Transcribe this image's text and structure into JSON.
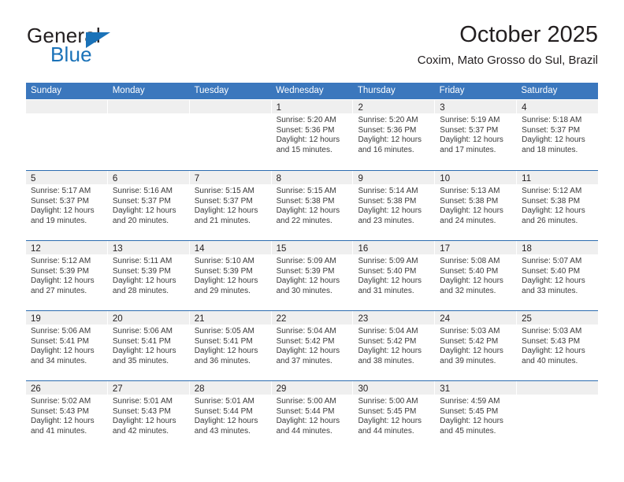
{
  "brand": {
    "name_part1": "General",
    "name_part2": "Blue",
    "triangle_icon": "triangle-icon",
    "accent_color": "#1a72b8"
  },
  "header": {
    "month_title": "October 2025",
    "location": "Coxim, Mato Grosso do Sul, Brazil"
  },
  "calendar": {
    "header_color": "#3b77bd",
    "row_divider_color": "#2c6cb0",
    "day_band_color": "#efefef",
    "weekdays": [
      "Sunday",
      "Monday",
      "Tuesday",
      "Wednesday",
      "Thursday",
      "Friday",
      "Saturday"
    ],
    "weeks": [
      [
        {
          "day": "",
          "empty": true
        },
        {
          "day": "",
          "empty": true
        },
        {
          "day": "",
          "empty": true
        },
        {
          "day": "1",
          "sunrise": "Sunrise: 5:20 AM",
          "sunset": "Sunset: 5:36 PM",
          "daylight_1": "Daylight: 12 hours",
          "daylight_2": "and 15 minutes."
        },
        {
          "day": "2",
          "sunrise": "Sunrise: 5:20 AM",
          "sunset": "Sunset: 5:36 PM",
          "daylight_1": "Daylight: 12 hours",
          "daylight_2": "and 16 minutes."
        },
        {
          "day": "3",
          "sunrise": "Sunrise: 5:19 AM",
          "sunset": "Sunset: 5:37 PM",
          "daylight_1": "Daylight: 12 hours",
          "daylight_2": "and 17 minutes."
        },
        {
          "day": "4",
          "sunrise": "Sunrise: 5:18 AM",
          "sunset": "Sunset: 5:37 PM",
          "daylight_1": "Daylight: 12 hours",
          "daylight_2": "and 18 minutes."
        }
      ],
      [
        {
          "day": "5",
          "sunrise": "Sunrise: 5:17 AM",
          "sunset": "Sunset: 5:37 PM",
          "daylight_1": "Daylight: 12 hours",
          "daylight_2": "and 19 minutes."
        },
        {
          "day": "6",
          "sunrise": "Sunrise: 5:16 AM",
          "sunset": "Sunset: 5:37 PM",
          "daylight_1": "Daylight: 12 hours",
          "daylight_2": "and 20 minutes."
        },
        {
          "day": "7",
          "sunrise": "Sunrise: 5:15 AM",
          "sunset": "Sunset: 5:37 PM",
          "daylight_1": "Daylight: 12 hours",
          "daylight_2": "and 21 minutes."
        },
        {
          "day": "8",
          "sunrise": "Sunrise: 5:15 AM",
          "sunset": "Sunset: 5:38 PM",
          "daylight_1": "Daylight: 12 hours",
          "daylight_2": "and 22 minutes."
        },
        {
          "day": "9",
          "sunrise": "Sunrise: 5:14 AM",
          "sunset": "Sunset: 5:38 PM",
          "daylight_1": "Daylight: 12 hours",
          "daylight_2": "and 23 minutes."
        },
        {
          "day": "10",
          "sunrise": "Sunrise: 5:13 AM",
          "sunset": "Sunset: 5:38 PM",
          "daylight_1": "Daylight: 12 hours",
          "daylight_2": "and 24 minutes."
        },
        {
          "day": "11",
          "sunrise": "Sunrise: 5:12 AM",
          "sunset": "Sunset: 5:38 PM",
          "daylight_1": "Daylight: 12 hours",
          "daylight_2": "and 26 minutes."
        }
      ],
      [
        {
          "day": "12",
          "sunrise": "Sunrise: 5:12 AM",
          "sunset": "Sunset: 5:39 PM",
          "daylight_1": "Daylight: 12 hours",
          "daylight_2": "and 27 minutes."
        },
        {
          "day": "13",
          "sunrise": "Sunrise: 5:11 AM",
          "sunset": "Sunset: 5:39 PM",
          "daylight_1": "Daylight: 12 hours",
          "daylight_2": "and 28 minutes."
        },
        {
          "day": "14",
          "sunrise": "Sunrise: 5:10 AM",
          "sunset": "Sunset: 5:39 PM",
          "daylight_1": "Daylight: 12 hours",
          "daylight_2": "and 29 minutes."
        },
        {
          "day": "15",
          "sunrise": "Sunrise: 5:09 AM",
          "sunset": "Sunset: 5:39 PM",
          "daylight_1": "Daylight: 12 hours",
          "daylight_2": "and 30 minutes."
        },
        {
          "day": "16",
          "sunrise": "Sunrise: 5:09 AM",
          "sunset": "Sunset: 5:40 PM",
          "daylight_1": "Daylight: 12 hours",
          "daylight_2": "and 31 minutes."
        },
        {
          "day": "17",
          "sunrise": "Sunrise: 5:08 AM",
          "sunset": "Sunset: 5:40 PM",
          "daylight_1": "Daylight: 12 hours",
          "daylight_2": "and 32 minutes."
        },
        {
          "day": "18",
          "sunrise": "Sunrise: 5:07 AM",
          "sunset": "Sunset: 5:40 PM",
          "daylight_1": "Daylight: 12 hours",
          "daylight_2": "and 33 minutes."
        }
      ],
      [
        {
          "day": "19",
          "sunrise": "Sunrise: 5:06 AM",
          "sunset": "Sunset: 5:41 PM",
          "daylight_1": "Daylight: 12 hours",
          "daylight_2": "and 34 minutes."
        },
        {
          "day": "20",
          "sunrise": "Sunrise: 5:06 AM",
          "sunset": "Sunset: 5:41 PM",
          "daylight_1": "Daylight: 12 hours",
          "daylight_2": "and 35 minutes."
        },
        {
          "day": "21",
          "sunrise": "Sunrise: 5:05 AM",
          "sunset": "Sunset: 5:41 PM",
          "daylight_1": "Daylight: 12 hours",
          "daylight_2": "and 36 minutes."
        },
        {
          "day": "22",
          "sunrise": "Sunrise: 5:04 AM",
          "sunset": "Sunset: 5:42 PM",
          "daylight_1": "Daylight: 12 hours",
          "daylight_2": "and 37 minutes."
        },
        {
          "day": "23",
          "sunrise": "Sunrise: 5:04 AM",
          "sunset": "Sunset: 5:42 PM",
          "daylight_1": "Daylight: 12 hours",
          "daylight_2": "and 38 minutes."
        },
        {
          "day": "24",
          "sunrise": "Sunrise: 5:03 AM",
          "sunset": "Sunset: 5:42 PM",
          "daylight_1": "Daylight: 12 hours",
          "daylight_2": "and 39 minutes."
        },
        {
          "day": "25",
          "sunrise": "Sunrise: 5:03 AM",
          "sunset": "Sunset: 5:43 PM",
          "daylight_1": "Daylight: 12 hours",
          "daylight_2": "and 40 minutes."
        }
      ],
      [
        {
          "day": "26",
          "sunrise": "Sunrise: 5:02 AM",
          "sunset": "Sunset: 5:43 PM",
          "daylight_1": "Daylight: 12 hours",
          "daylight_2": "and 41 minutes."
        },
        {
          "day": "27",
          "sunrise": "Sunrise: 5:01 AM",
          "sunset": "Sunset: 5:43 PM",
          "daylight_1": "Daylight: 12 hours",
          "daylight_2": "and 42 minutes."
        },
        {
          "day": "28",
          "sunrise": "Sunrise: 5:01 AM",
          "sunset": "Sunset: 5:44 PM",
          "daylight_1": "Daylight: 12 hours",
          "daylight_2": "and 43 minutes."
        },
        {
          "day": "29",
          "sunrise": "Sunrise: 5:00 AM",
          "sunset": "Sunset: 5:44 PM",
          "daylight_1": "Daylight: 12 hours",
          "daylight_2": "and 44 minutes."
        },
        {
          "day": "30",
          "sunrise": "Sunrise: 5:00 AM",
          "sunset": "Sunset: 5:45 PM",
          "daylight_1": "Daylight: 12 hours",
          "daylight_2": "and 44 minutes."
        },
        {
          "day": "31",
          "sunrise": "Sunrise: 4:59 AM",
          "sunset": "Sunset: 5:45 PM",
          "daylight_1": "Daylight: 12 hours",
          "daylight_2": "and 45 minutes."
        },
        {
          "day": "",
          "empty": true
        }
      ]
    ]
  }
}
